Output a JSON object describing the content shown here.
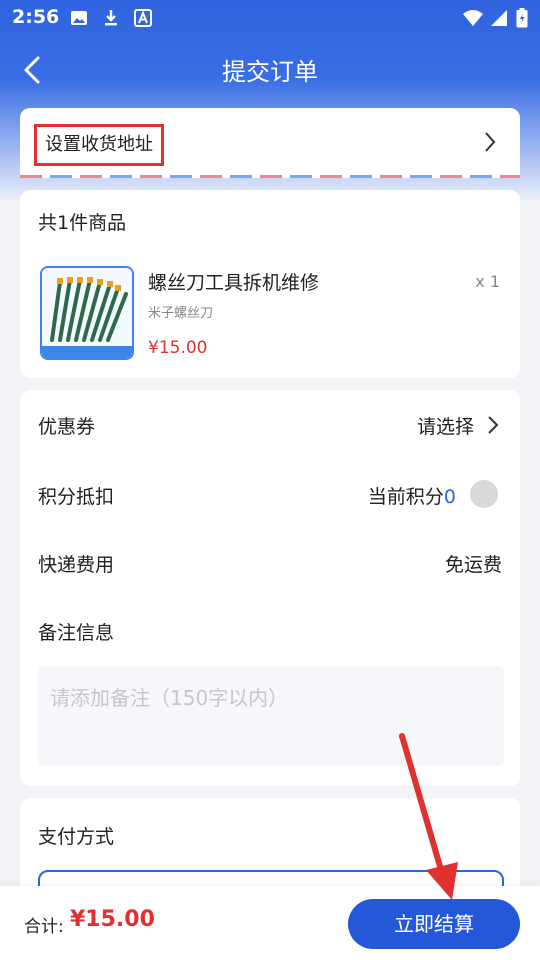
{
  "status_bar": {
    "time": "2:56",
    "icons": [
      "image-icon",
      "download-icon",
      "translate-icon",
      "wifi-icon",
      "signal-icon",
      "battery-icon"
    ]
  },
  "header": {
    "title": "提交订单"
  },
  "address": {
    "label": "设置收货地址"
  },
  "goods": {
    "count_label": "共1件商品",
    "product_name": "螺丝刀工具拆机维修",
    "product_sub": "米子螺丝刀",
    "price": "¥15.00",
    "quantity": "x 1"
  },
  "options": {
    "coupon_label": "优惠券",
    "coupon_value": "请选择",
    "points_label": "积分抵扣",
    "points_prefix": "当前积分",
    "points_value": "0",
    "shipping_label": "快递费用",
    "shipping_value": "免运费",
    "remark_label": "备注信息",
    "remark_placeholder": "请添加备注（150字以内）"
  },
  "payment": {
    "title": "支付方式"
  },
  "footer": {
    "total_label": "合计:",
    "total_value": "¥15.00",
    "submit_label": "立即结算"
  },
  "colors": {
    "primary": "#2458d8",
    "price": "#e03030",
    "annotation": "#e03030"
  }
}
